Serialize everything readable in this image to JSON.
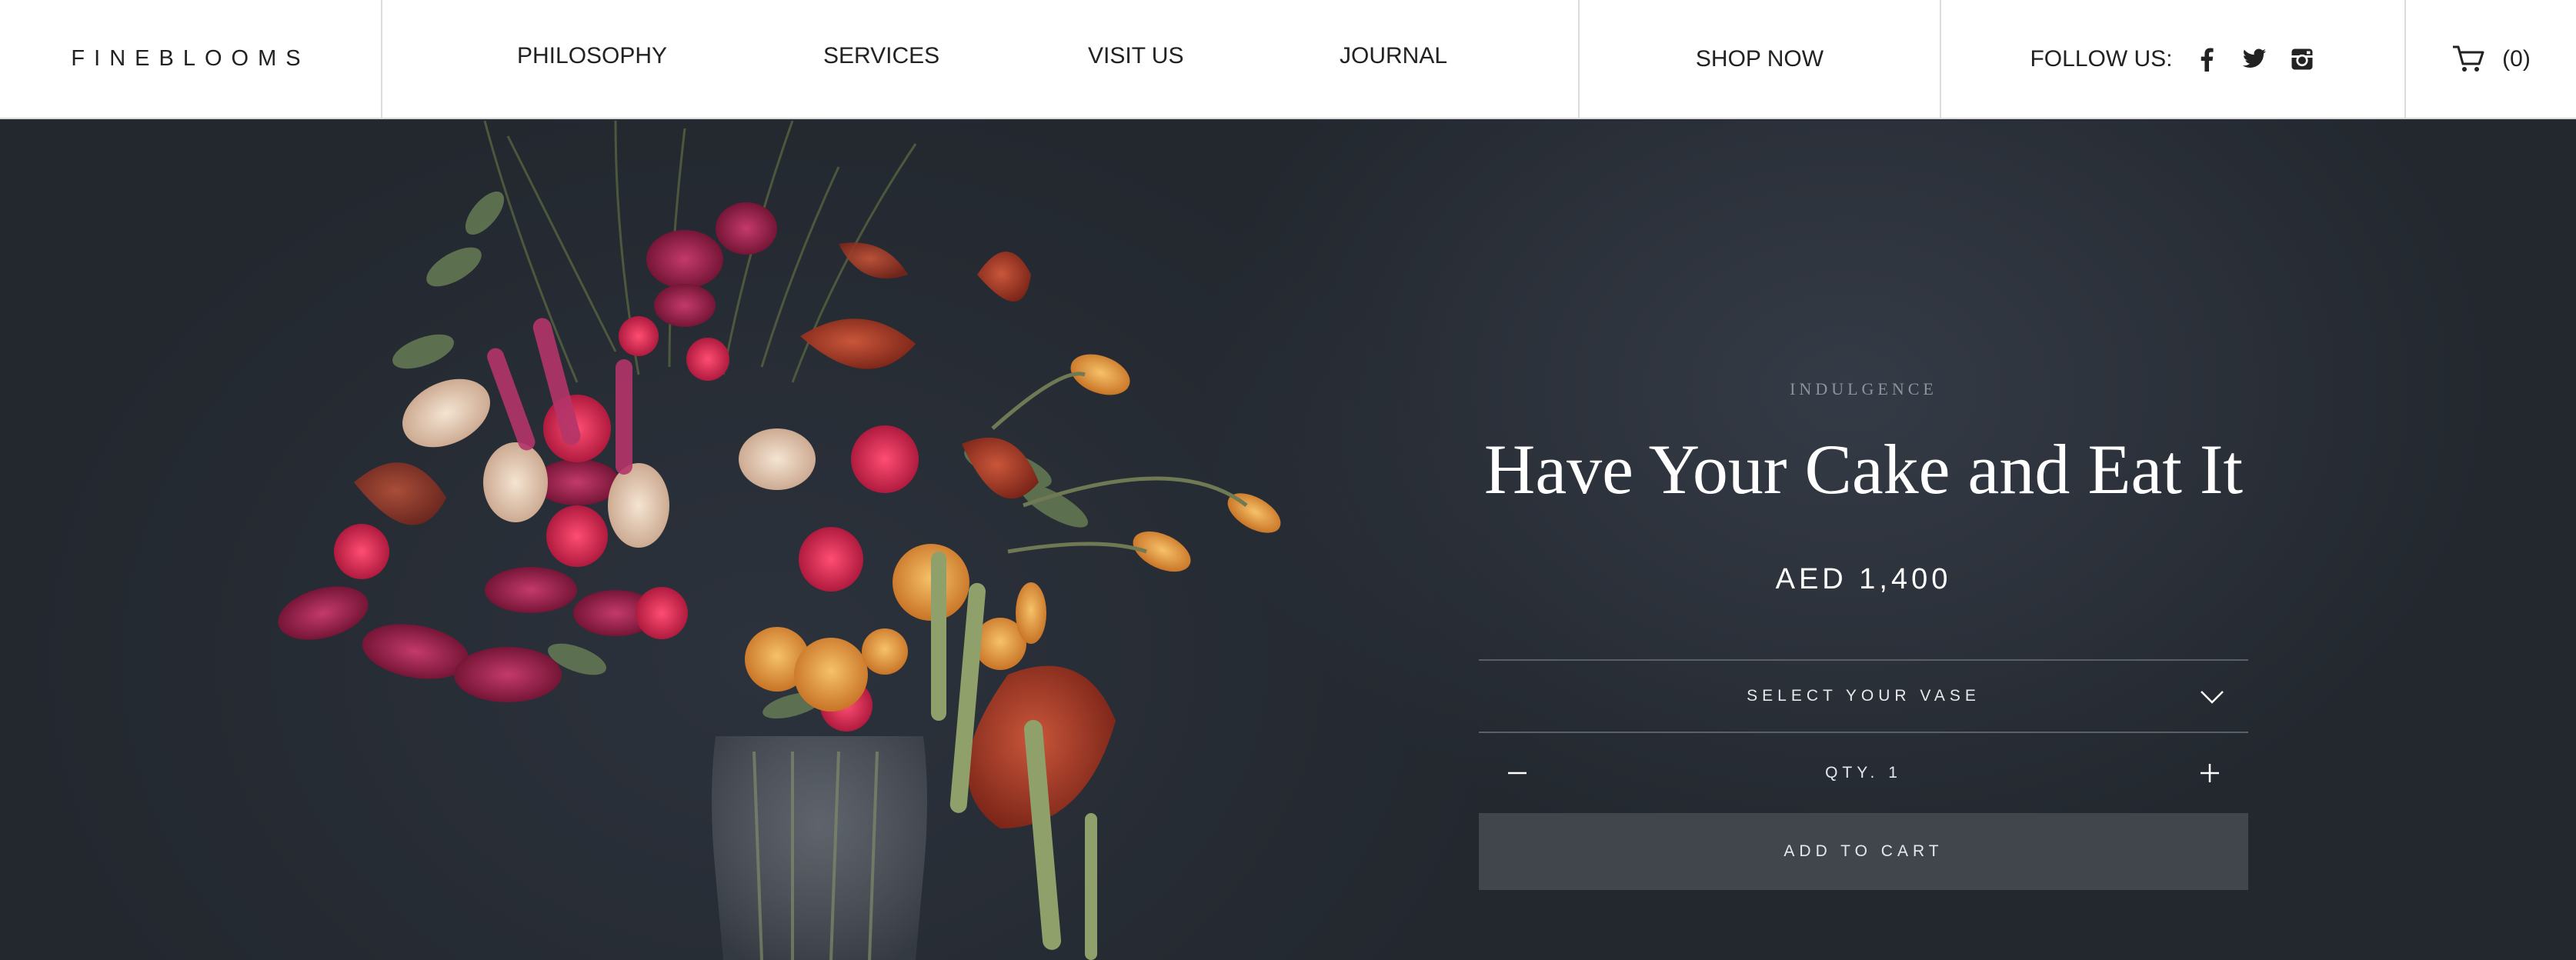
{
  "header": {
    "brand": "FINEBLOOMS",
    "nav": [
      "PHILOSOPHY",
      "SERVICES",
      "VISIT US",
      "JOURNAL"
    ],
    "shop": "SHOP NOW",
    "follow_label": "FOLLOW US:",
    "social_icons": [
      "facebook-icon",
      "twitter-icon",
      "instagram-icon"
    ],
    "cart_count": "(0)"
  },
  "product": {
    "category": "INDULGENCE",
    "title": "Have Your Cake and Eat It",
    "price": "AED 1,400",
    "vase_select_label": "SELECT YOUR VASE",
    "qty_label": "QTY. 1",
    "add_to_cart_label": "ADD TO CART"
  },
  "colors": {
    "background": "#262b34",
    "button": "#41454c",
    "header_bg": "#ffffff"
  }
}
